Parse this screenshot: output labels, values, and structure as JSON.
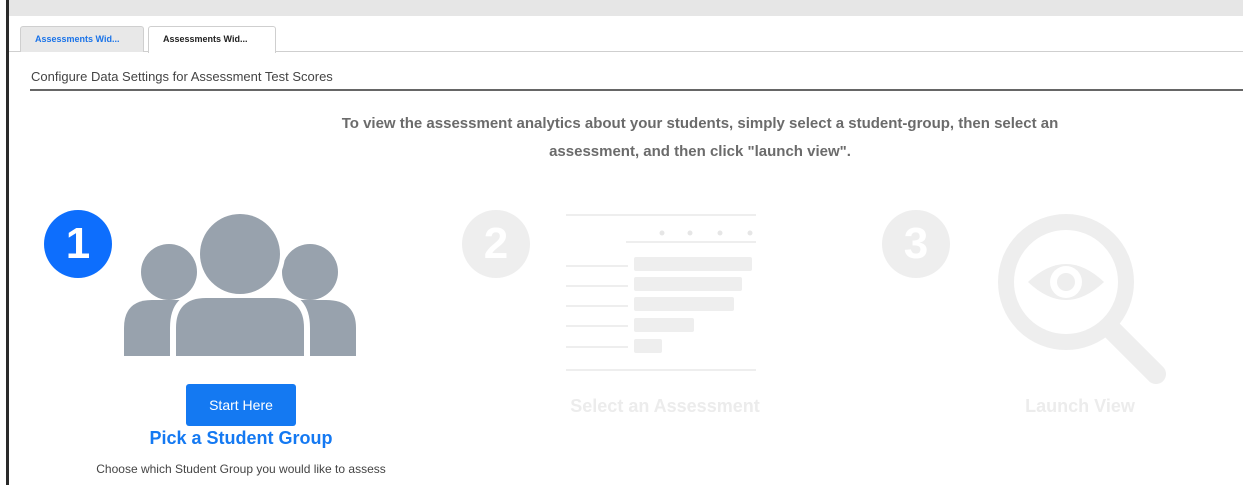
{
  "tabs": [
    {
      "label": "Assessments Wid..."
    },
    {
      "label": "Assessments Wid..."
    }
  ],
  "panel": {
    "title": "Configure Data Settings for Assessment Test Scores"
  },
  "instructions": {
    "line1": "To view the assessment analytics about your students, simply select a student-group, then select an",
    "line2": "assessment, and then click \"launch view\"."
  },
  "steps": [
    {
      "number": "1",
      "icon": "user-group-icon",
      "button_label": "Start Here",
      "title": "Pick a Student Group",
      "description": "Choose which Student Group you would like to assess",
      "active": true
    },
    {
      "number": "2",
      "icon": "assessment-table-icon",
      "title": "Select an Assessment",
      "active": false
    },
    {
      "number": "3",
      "icon": "magnifier-eye-icon",
      "title": "Launch View",
      "active": false
    }
  ],
  "colors": {
    "accent": "#1479f2",
    "step_active": "#0d6efd",
    "icon_active": "#98a2ad",
    "inactive": "#eeeeee",
    "instruction_text": "#6b6b6b"
  }
}
